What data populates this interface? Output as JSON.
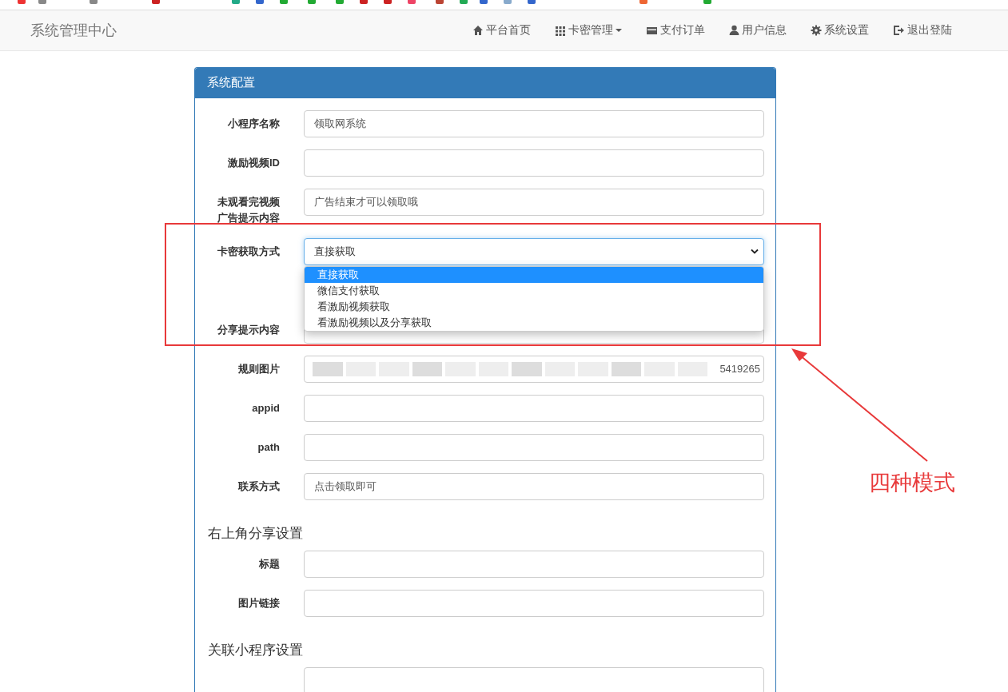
{
  "navbar": {
    "brand": "系统管理中心",
    "items": [
      {
        "label": "平台首页",
        "kind": "home",
        "dropdown": false
      },
      {
        "label": "卡密管理",
        "kind": "grid",
        "dropdown": true
      },
      {
        "label": "支付订单",
        "kind": "card",
        "dropdown": false
      },
      {
        "label": "用户信息",
        "kind": "user",
        "dropdown": false
      },
      {
        "label": "系统设置",
        "kind": "gear",
        "dropdown": false
      },
      {
        "label": "退出登陆",
        "kind": "logout",
        "dropdown": false
      }
    ]
  },
  "panel": {
    "title": "系统配置",
    "sections": [
      {
        "fields": [
          {
            "label": "小程序名称",
            "kind": "text",
            "value": "领取网系统"
          },
          {
            "label": "激励视频ID",
            "kind": "text"
          },
          {
            "label": "未观看完视频广告提示内容",
            "kind": "text",
            "value": "广告结束才可以领取哦"
          },
          {
            "label": "卡密获取方式",
            "kind": "select",
            "value": "直接获取",
            "expanded": true,
            "options": [
              {
                "label": "直接获取",
                "selected": true
              },
              {
                "label": "微信支付获取",
                "selected": false
              },
              {
                "label": "看激励视频获取",
                "selected": false
              },
              {
                "label": "看激励视频以及分享获取",
                "selected": false
              }
            ]
          },
          {
            "label": "分享提示内容",
            "kind": "text"
          },
          {
            "label": "规则图片",
            "kind": "text",
            "value": "5419265",
            "redacted": true
          },
          {
            "label": "appid",
            "kind": "text"
          },
          {
            "label": "path",
            "kind": "text"
          },
          {
            "label": "联系方式",
            "kind": "text",
            "value": "点击领取即可"
          }
        ]
      },
      {
        "heading": "右上角分享设置",
        "fields": [
          {
            "label": "标题",
            "kind": "text"
          },
          {
            "label": "图片链接",
            "kind": "text"
          }
        ]
      },
      {
        "heading": "关联小程序设置",
        "fields": [
          {
            "kind": "text"
          }
        ]
      }
    ]
  },
  "annotation": {
    "text": "四种模式"
  }
}
